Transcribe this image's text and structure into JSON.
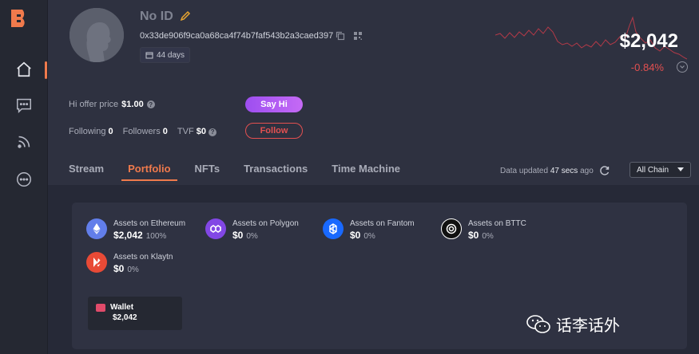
{
  "profile": {
    "name": "No ID",
    "address": "0x33de906f9ca0a68ca4f74b7faf543b2a3caed397",
    "days": "44 days",
    "balance": "$2,042",
    "change": "-0.84%"
  },
  "social": {
    "hi_offer_label": "Hi offer price",
    "hi_offer_value": "$1.00",
    "say_hi_label": "Say Hi",
    "following_label": "Following",
    "following_value": "0",
    "followers_label": "Followers",
    "followers_value": "0",
    "tvf_label": "TVF",
    "tvf_value": "$0",
    "follow_label": "Follow"
  },
  "tabs": [
    {
      "label": "Stream"
    },
    {
      "label": "Portfolio",
      "active": true
    },
    {
      "label": "NFTs"
    },
    {
      "label": "Transactions"
    },
    {
      "label": "Time Machine"
    }
  ],
  "update": {
    "prefix": "Data updated",
    "time": "47 secs",
    "suffix": "ago"
  },
  "chain_select": {
    "value": "All Chain"
  },
  "assets": [
    {
      "name": "Assets on Ethereum",
      "value": "$2,042",
      "pct": "100%",
      "icon": "ethereum-icon",
      "color": "#627eea"
    },
    {
      "name": "Assets on Polygon",
      "value": "$0",
      "pct": "0%",
      "icon": "polygon-icon",
      "color": "#8247e5"
    },
    {
      "name": "Assets on Fantom",
      "value": "$0",
      "pct": "0%",
      "icon": "fantom-icon",
      "color": "#1969ff"
    },
    {
      "name": "Assets on BTTC",
      "value": "$0",
      "pct": "0%",
      "icon": "bttc-icon",
      "color": "#111111"
    },
    {
      "name": "Assets on Klaytn",
      "value": "$0",
      "pct": "0%",
      "icon": "klaytn-icon",
      "color": "#e84a36"
    }
  ],
  "wallet": {
    "label": "Wallet",
    "value": "$2,042"
  },
  "watermark": {
    "text": "话李话外"
  },
  "colors": {
    "accent": "#f07a4c",
    "negative": "#e35050",
    "say_hi_gradient": "#9d4ef0",
    "background": "#2b2e3a"
  }
}
